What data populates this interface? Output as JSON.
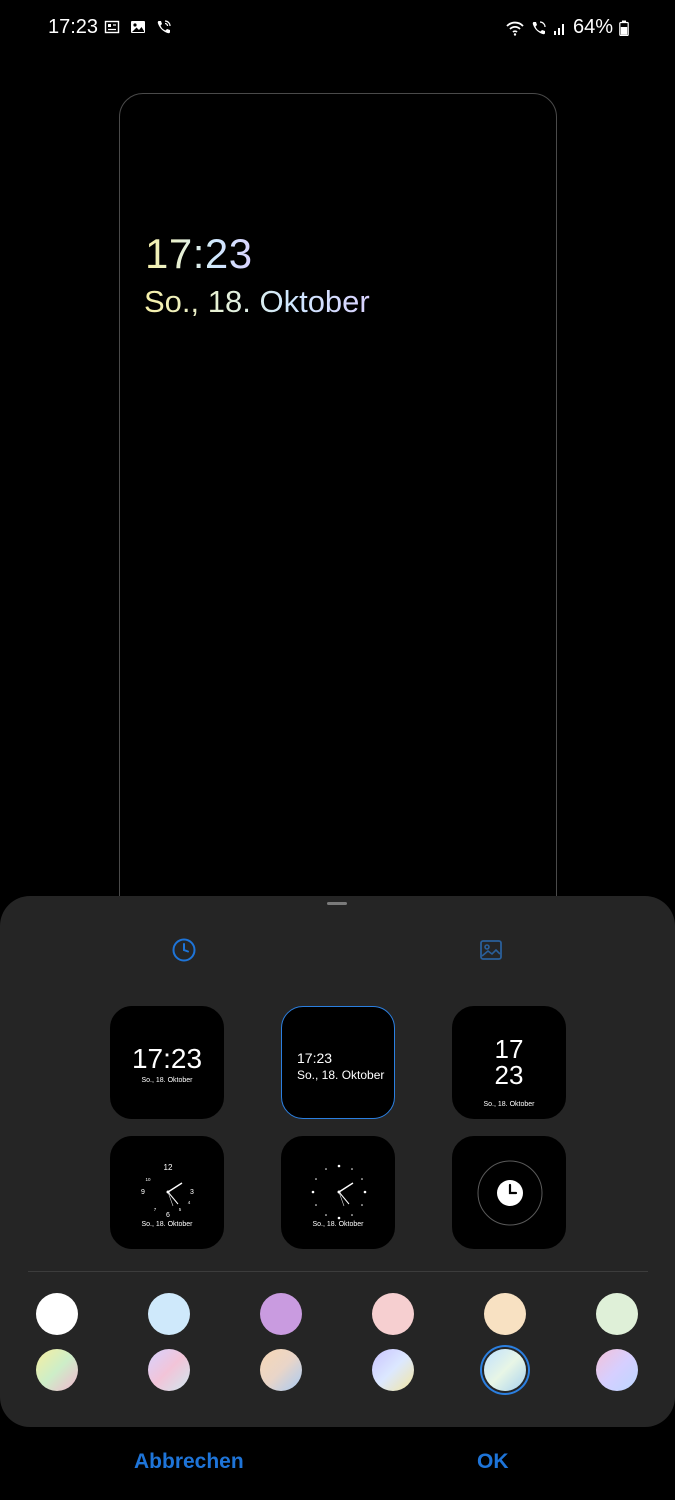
{
  "status_bar": {
    "time": "17:23",
    "battery": "64%",
    "left_icons": [
      "news-icon",
      "image-icon",
      "wifi-call-icon"
    ],
    "right_icons": [
      "wifi-icon",
      "wifi-call-icon",
      "signal-icon",
      "battery-icon"
    ]
  },
  "preview": {
    "time": "17:23",
    "date": "So., 18. Oktober"
  },
  "tabs": [
    {
      "icon": "clock-icon",
      "active": true,
      "color": "#1e74d8"
    },
    {
      "icon": "image-icon",
      "active": false,
      "color": "#2a5f9a"
    }
  ],
  "clock_styles": {
    "digital_large": {
      "time": "17:23",
      "date": "So., 18. Oktober"
    },
    "digital_left": {
      "time": "17:23",
      "date": "So., 18. Oktober",
      "selected": true
    },
    "digital_stacked": {
      "hour": "17",
      "minute": "23",
      "date": "So., 18. Oktober"
    },
    "analog_numbers": {
      "numbers": [
        "12",
        "3",
        "6",
        "9",
        "10",
        "4",
        "5",
        "7"
      ],
      "date": "So., 18. Oktober"
    },
    "analog_dots": {
      "date": "So., 18. Oktober"
    },
    "clock_icon": {
      "icon": "clock-icon"
    }
  },
  "colors": {
    "accent": "#1e74d8",
    "solid": [
      "#ffffff",
      "#cfe9fb",
      "#c99be0",
      "#f6cfd0",
      "#f8e1c2",
      "#dff0d8"
    ],
    "gradient_selected_index": 10
  },
  "buttons": {
    "cancel": "Abbrechen",
    "ok": "OK"
  }
}
